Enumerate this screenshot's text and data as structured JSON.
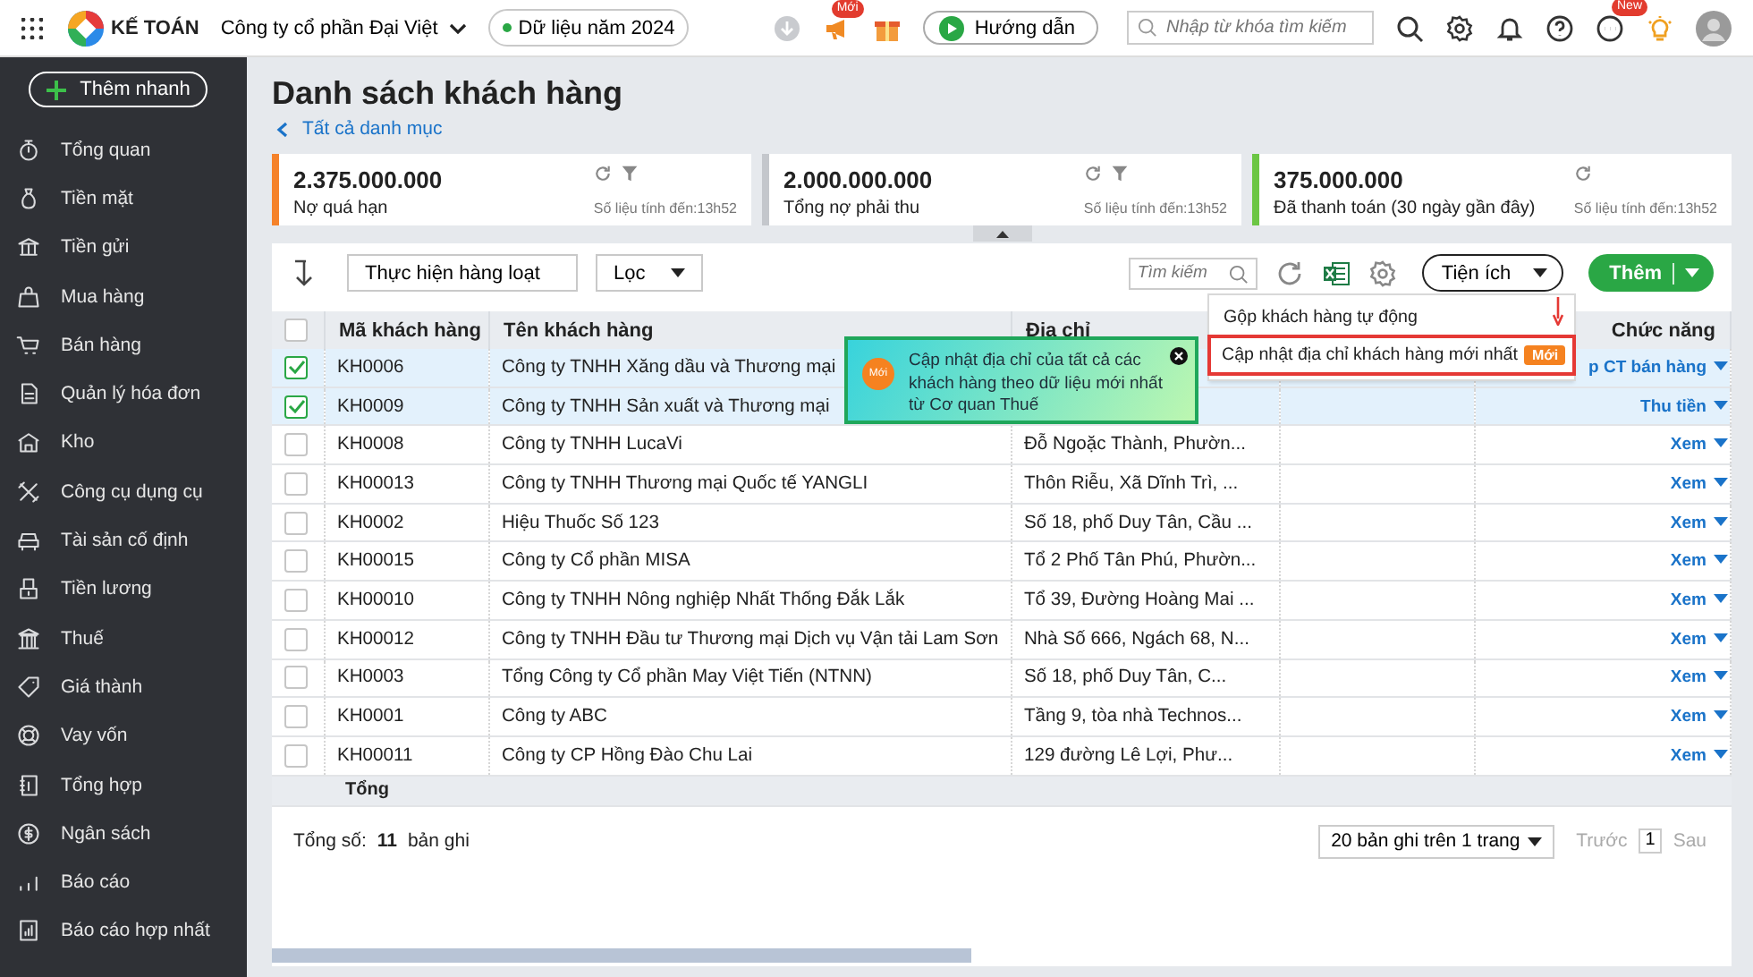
{
  "topbar": {
    "app_name": "KẾ TOÁN",
    "company": "Công ty cổ phần Đại Việt",
    "data_year": "Dữ liệu năm 2024",
    "announce_badge": "Mới",
    "guide_button": "Hướng dẫn",
    "search": {
      "placeholder": "Nhập từ khóa tìm kiếm"
    },
    "chat_badge": "New"
  },
  "sidebar": {
    "quick_add": "Thêm nhanh",
    "items": [
      {
        "label": "Tổng quan"
      },
      {
        "label": "Tiền mặt"
      },
      {
        "label": "Tiền gửi"
      },
      {
        "label": "Mua hàng"
      },
      {
        "label": "Bán hàng"
      },
      {
        "label": "Quản lý hóa đơn"
      },
      {
        "label": "Kho"
      },
      {
        "label": "Công cụ dụng cụ"
      },
      {
        "label": "Tài sản cố định"
      },
      {
        "label": "Tiền lương"
      },
      {
        "label": "Thuế"
      },
      {
        "label": "Giá thành"
      },
      {
        "label": "Vay vốn"
      },
      {
        "label": "Tổng hợp"
      },
      {
        "label": "Ngân sách"
      },
      {
        "label": "Báo cáo"
      },
      {
        "label": "Báo cáo hợp nhất"
      }
    ]
  },
  "page": {
    "title": "Danh sách khách hàng",
    "back_link": "Tất cả danh mục"
  },
  "cards": [
    {
      "value": "2.375.000.000",
      "label": "Nợ quá hạn",
      "note": "Số liệu tính đến:13h52",
      "color": "#f5822a",
      "filter": true
    },
    {
      "value": "2.000.000.000",
      "label": "Tổng nợ phải thu",
      "note": "Số liệu tính đến:13h52",
      "color": "#c4c7cc",
      "filter": true
    },
    {
      "value": "375.000.000",
      "label": "Đã thanh toán (30 ngày gần đây)",
      "note": "Số liệu tính đến:13h52",
      "color": "#6cc644",
      "filter": false
    }
  ],
  "toolbar": {
    "bulk_action": "Thực hiện hàng loạt",
    "filter": "Lọc",
    "search": {
      "placeholder": "Tìm kiếm"
    },
    "utilities": "Tiện ích",
    "add": "Thêm"
  },
  "table": {
    "header_checkbox": {
      "checked": false
    },
    "columns": [
      "Mã khách hàng",
      "Tên khách hàng",
      "Địa chỉ",
      "Chức năng"
    ],
    "rows": [
      {
        "checked": true,
        "code": "KH0006",
        "name": "Công ty TNHH Xăng dầu và Thương mại",
        "action": "p CT bán hàng"
      },
      {
        "checked": true,
        "code": "KH0009",
        "name": "Công ty TNHH Sản xuất và Thương mại",
        "action": "Thu tiền"
      },
      {
        "checked": false,
        "code": "KH0008",
        "name": "Công ty TNHH LucaVi",
        "address": "Đỗ Ngoặc Thành, Phườn...",
        "action": "Xem"
      },
      {
        "checked": false,
        "code": "KH00013",
        "name": "Công ty TNHH Thương mại Quốc tế YANGLI",
        "address": "Thôn Riễu, Xã Dĩnh Trì, ...",
        "action": "Xem"
      },
      {
        "checked": false,
        "code": "KH0002",
        "name": "Hiệu Thuốc Số 123",
        "address": "Số 18, phố Duy Tân, Cầu ...",
        "action": "Xem"
      },
      {
        "checked": false,
        "code": "KH00015",
        "name": "Công ty Cổ phần MISA",
        "address": "Tổ 2 Phố Tân Phú, Phườn...",
        "action": "Xem"
      },
      {
        "checked": false,
        "code": "KH00010",
        "name": "Công ty TNHH Nông nghiệp Nhất Thống Đắk Lắk",
        "address": "Tổ 39, Đường Hoàng Mai ...",
        "action": "Xem"
      },
      {
        "checked": false,
        "code": "KH00012",
        "name": "Công ty TNHH Đầu tư Thương mại Dịch vụ Vận tải Lam Sơn",
        "address": "Nhà Số 666, Ngách 68, N...",
        "action": "Xem"
      },
      {
        "checked": false,
        "code": "KH0003",
        "name": "Tổng Công ty Cổ phần May Việt Tiến (NTNN)",
        "address": "Số 18, phố Duy Tân, C...",
        "action": "Xem"
      },
      {
        "checked": false,
        "code": "KH0001",
        "name": "Công ty ABC",
        "address": "Tầng 9, tòa nhà Technos...",
        "action": "Xem"
      },
      {
        "checked": false,
        "code": "KH00011",
        "name": "Công ty CP Hồng Đào Chu Lai",
        "address": "129 đường Lê Lợi, Phư...",
        "action": "Xem"
      }
    ],
    "total_label": "Tổng"
  },
  "footer": {
    "total_prefix": "Tổng số:",
    "total_count": "11",
    "total_suffix": "bản ghi",
    "page_size": "20 bản ghi trên 1 trang",
    "prev": "Trước",
    "page": "1",
    "next": "Sau"
  },
  "utilities_menu": {
    "items": [
      {
        "label": "Gộp khách hàng tự động",
        "highlighted": false
      },
      {
        "label": "Cập nhật địa chỉ khách hàng mới nhất",
        "badge": "Mới",
        "highlighted": true
      }
    ]
  },
  "tooltip": {
    "badge": "Mới",
    "text": "Cập nhật địa chỉ của tất cả các khách hàng theo dữ liệu mới nhất từ Cơ quan Thuế"
  }
}
